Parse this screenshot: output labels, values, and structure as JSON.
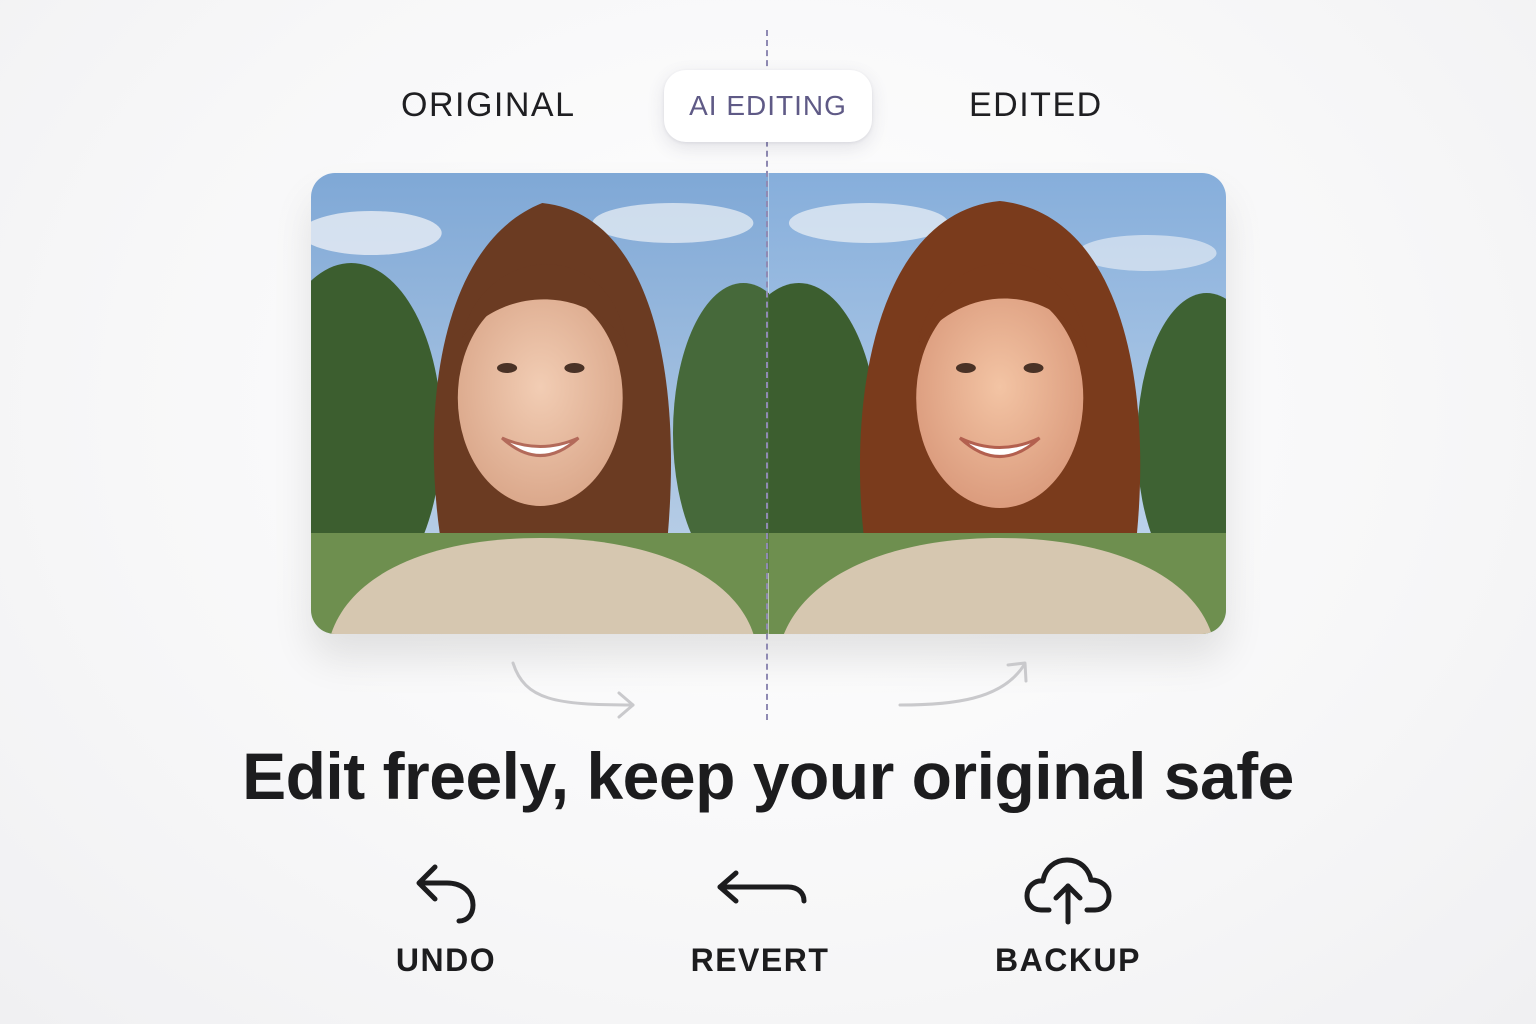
{
  "labels": {
    "left": "ORIGINAL",
    "center": "AI EDITING",
    "right": "EDITED"
  },
  "headline": "Edit freely, keep your original safe",
  "actions": [
    {
      "label": "UNDO",
      "icon": "undo-icon"
    },
    {
      "label": "REVERT",
      "icon": "revert-arrow-icon"
    },
    {
      "label": "BACKUP",
      "icon": "cloud-upload-icon"
    }
  ],
  "colors": {
    "accent": "#5f5a86",
    "divider": "#8f8ab3",
    "text": "#1c1c1e",
    "background": "#f7f7f8"
  }
}
